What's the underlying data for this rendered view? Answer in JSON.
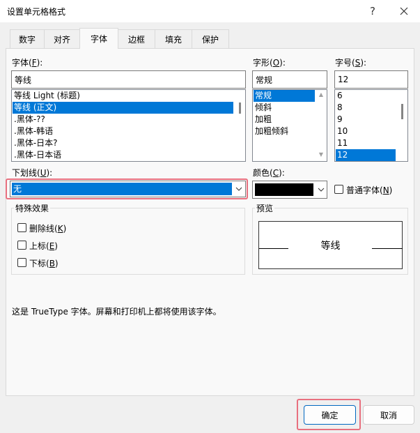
{
  "dialog": {
    "title": "设置单元格格式",
    "help": "?"
  },
  "tabs": [
    "数字",
    "对齐",
    "字体",
    "边框",
    "填充",
    "保护"
  ],
  "font": {
    "label": "字体(",
    "key": "F",
    "label_end": "):",
    "value": "等线",
    "items": [
      "等线 Light (标题)",
      "等线 (正文)",
      ".黑体-??",
      ".黑体-韩语",
      ".黑体-日本?",
      ".黑体-日本语"
    ],
    "selected_index": 1
  },
  "style": {
    "label": "字形(",
    "key": "O",
    "label_end": "):",
    "value": "常规",
    "items": [
      "常规",
      "倾斜",
      "加粗",
      "加粗倾斜"
    ],
    "selected_index": 0
  },
  "size": {
    "label": "字号(",
    "key": "S",
    "label_end": "):",
    "value": "12",
    "items": [
      "6",
      "8",
      "9",
      "10",
      "11",
      "12"
    ],
    "selected_index": 5
  },
  "underline": {
    "label": "下划线(",
    "key": "U",
    "label_end": "):",
    "value": "无"
  },
  "color": {
    "label": "颜色(",
    "key": "C",
    "label_end": "):",
    "swatch": "#000000"
  },
  "normal_font": {
    "label": "普通字体(",
    "key": "N",
    "label_end": ")"
  },
  "effects": {
    "title": "特殊效果",
    "strike": {
      "label": "删除线(",
      "key": "K",
      "label_end": ")"
    },
    "superscript": {
      "label": "上标(",
      "key": "E",
      "label_end": ")"
    },
    "subscript": {
      "label": "下标(",
      "key": "B",
      "label_end": ")"
    }
  },
  "preview": {
    "title": "预览",
    "sample": "等线"
  },
  "info": "这是 TrueType 字体。屏幕和打印机上都将使用该字体。",
  "buttons": {
    "ok": "确定",
    "cancel": "取消"
  }
}
